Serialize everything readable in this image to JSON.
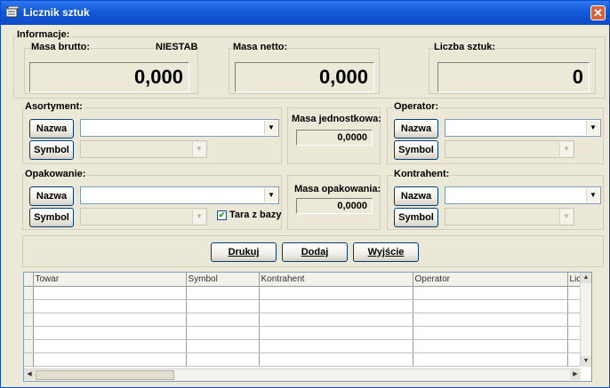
{
  "window": {
    "title": "Licznik sztuk",
    "close_glyph": "✕",
    "accent_color": "#1559D8"
  },
  "informacje": {
    "group_label": "Informacje:",
    "masa_brutto": {
      "label": "Masa brutto:",
      "status": "NIESTAB",
      "value": "0,000"
    },
    "masa_netto": {
      "label": "Masa netto:",
      "value": "0,000"
    },
    "liczba_sztuk": {
      "label": "Liczba sztuk:",
      "value": "0"
    }
  },
  "asortyment": {
    "group_label": "Asortyment:",
    "nazwa_button": "Nazwa",
    "symbol_button": "Symbol",
    "nazwa_value": "",
    "symbol_value": ""
  },
  "masa_jednostkowa": {
    "label": "Masa jednostkowa:",
    "value": "0,0000"
  },
  "operator": {
    "group_label": "Operator:",
    "nazwa_button": "Nazwa",
    "symbol_button": "Symbol",
    "nazwa_value": "",
    "symbol_value": ""
  },
  "opakowanie": {
    "group_label": "Opakowanie:",
    "nazwa_button": "Nazwa",
    "symbol_button": "Symbol",
    "tara_checkbox_label": "Tara z bazy",
    "tara_checked": true,
    "nazwa_value": "",
    "symbol_value": ""
  },
  "masa_opakowania": {
    "label": "Masa opakowania:",
    "value": "0,0000"
  },
  "kontrahent": {
    "group_label": "Kontrahent:",
    "nazwa_button": "Nazwa",
    "symbol_button": "Symbol",
    "nazwa_value": "",
    "symbol_value": ""
  },
  "actions": {
    "drukuj": "Drukuj",
    "dodaj": "Dodaj",
    "wyjscie": "Wyjście"
  },
  "table": {
    "columns": [
      "Towar",
      "Symbol",
      "Kontrahent",
      "Operator",
      "Liczba"
    ],
    "rows": [
      [
        "",
        "",
        "",
        "",
        ""
      ],
      [
        "",
        "",
        "",
        "",
        ""
      ],
      [
        "",
        "",
        "",
        "",
        ""
      ],
      [
        "",
        "",
        "",
        "",
        ""
      ],
      [
        "",
        "",
        "",
        "",
        ""
      ],
      [
        "",
        "",
        "",
        "",
        ""
      ]
    ]
  }
}
